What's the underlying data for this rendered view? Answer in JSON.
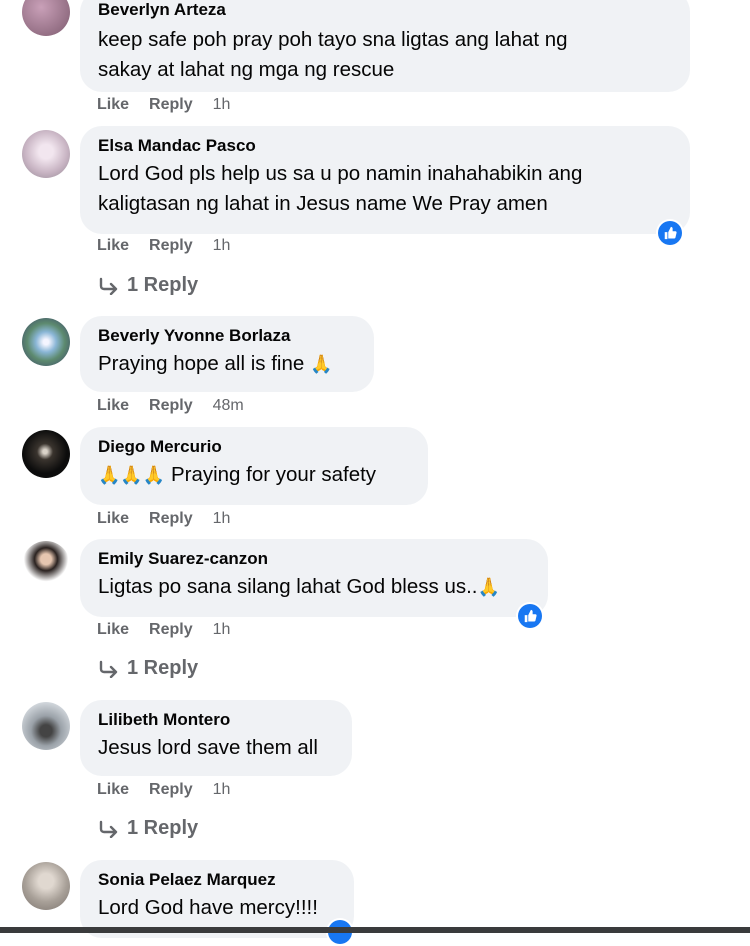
{
  "comments": [
    {
      "name": "Beverlyn Arteza",
      "lines": [
        "keep safe poh pray poh tayo sna ligtas ang lahat ng",
        "sakay at lahat ng mga ng rescue"
      ],
      "time": "1h"
    },
    {
      "name": "Elsa Mandac Pasco",
      "lines": [
        "Lord God pls help us sa u po namin inahahabikin ang",
        "kaligtasan ng lahat in Jesus name We Pray amen"
      ],
      "time": "1h",
      "replies": "1 Reply"
    },
    {
      "name": "Beverly Yvonne Borlaza",
      "text": "Praying hope all is fine",
      "time": "48m"
    },
    {
      "name": "Diego Mercurio",
      "text": "Praying for your safety",
      "time": "1h"
    },
    {
      "name": "Emily Suarez-canzon",
      "text": "Ligtas po sana silang lahat God bless us..",
      "time": "1h",
      "replies": "1 Reply"
    },
    {
      "name": "Lilibeth Montero",
      "text": "Jesus lord save them all",
      "time": "1h",
      "replies": "1 Reply"
    },
    {
      "name": "Sonia Pelaez Marquez",
      "text": "Lord God have mercy!!!!"
    }
  ],
  "actions": {
    "like": "Like",
    "reply": "Reply"
  },
  "colors": {
    "bubble": "#f0f2f5",
    "meta": "#65676b",
    "like_blue": "#1877f2"
  }
}
